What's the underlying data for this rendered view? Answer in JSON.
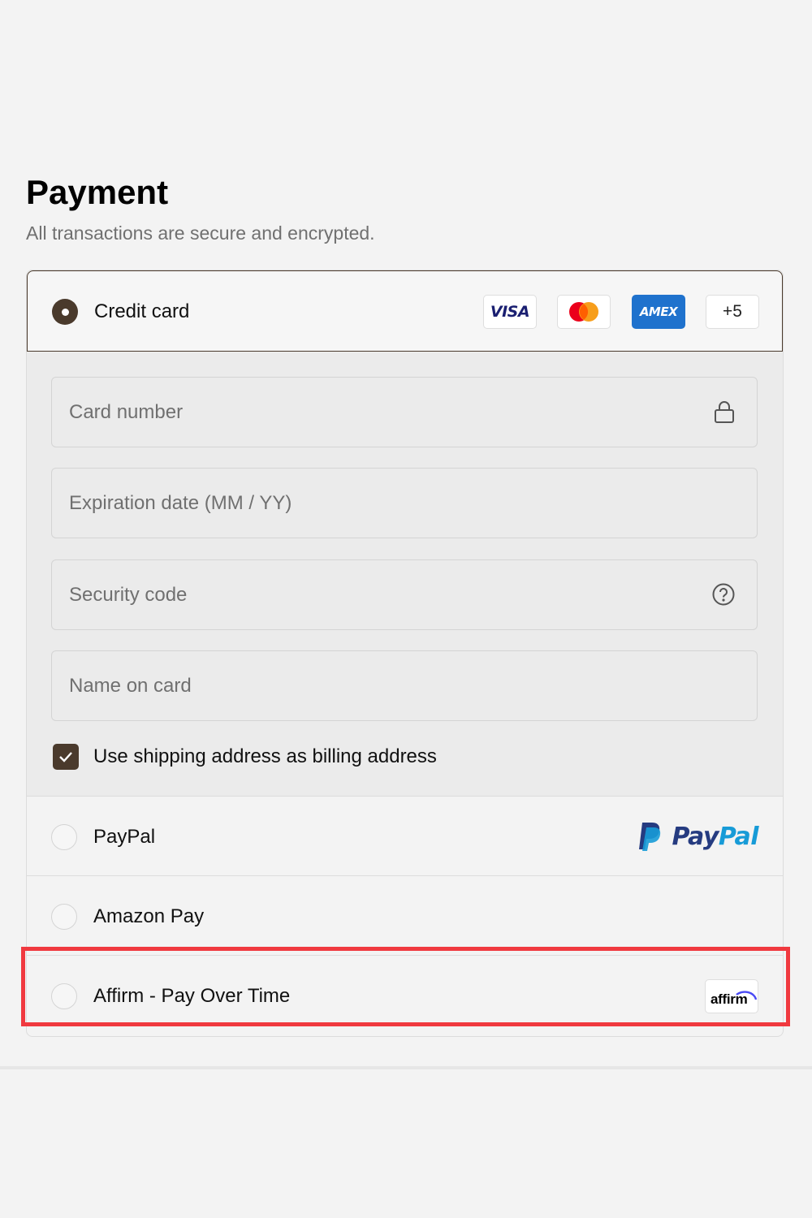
{
  "header": {
    "title": "Payment",
    "subtitle": "All transactions are secure and encrypted."
  },
  "credit_card": {
    "label": "Credit card",
    "selected": true,
    "brands": [
      "VISA",
      "Mastercard",
      "AMEX"
    ],
    "visa_text": "VISA",
    "amex_text": "AMEX",
    "more_brands": "+5",
    "fields": {
      "card_number": "Card number",
      "expiration": "Expiration date (MM / YY)",
      "security_code": "Security code",
      "name_on_card": "Name on card"
    },
    "billing_checkbox": {
      "label": "Use shipping address as billing address",
      "checked": true
    }
  },
  "paypal": {
    "label": "PayPal",
    "logo_text_pay": "Pay",
    "logo_text_pal": "Pal"
  },
  "amazon_pay": {
    "label": "Amazon Pay"
  },
  "affirm": {
    "label": "Affirm - Pay Over Time",
    "logo_text": "affirm"
  },
  "colors": {
    "accent": "#4a3a2c",
    "highlight": "#f0393f",
    "paypal_dark": "#253b80",
    "paypal_light": "#179bd7",
    "amex": "#1f72cd",
    "visa": "#1a1f71"
  }
}
